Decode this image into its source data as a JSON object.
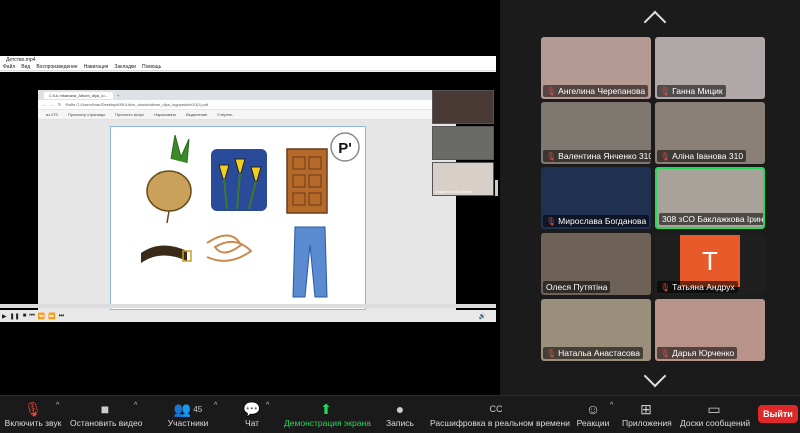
{
  "player": {
    "title": "Детство.mp4",
    "menu": [
      "Файл",
      "Вид",
      "Воспроизведение",
      "Навигация",
      "Закладки",
      "Помощь"
    ]
  },
  "browser": {
    "tab_title": "C:/Lk.mhahana_Albom_dlya_lo...",
    "url": "Файл  C:/Users/Ivan/Desktop/КЛК/Litvin_obuch/albom_dlya_logopeda%20(1).pdf",
    "zoom": "из 270",
    "tools": [
      "Просмотр страницы",
      "Прочесть вслух",
      "Нарисовать",
      "Выделение",
      "Стереть"
    ]
  },
  "pdf": {
    "badge": "Р'"
  },
  "mini_gallery": [
    {
      "name": ""
    },
    {
      "name": ""
    },
    {
      "name": "Angelina Kaka Zoom"
    }
  ],
  "gallery": [
    {
      "name": "Ангелина Черепанова",
      "muted": true,
      "bg": "#b59a93"
    },
    {
      "name": "Ганна Мицик",
      "muted": true,
      "bg": "#b0a8a8"
    },
    {
      "name": "Валентина Янченко  310",
      "muted": true,
      "bg": "#7f7870"
    },
    {
      "name": "Аліна Іванова 310",
      "muted": true,
      "bg": "#8a8078"
    },
    {
      "name": "Мирослава Богданова",
      "muted": true,
      "bg": "#203050"
    },
    {
      "name": "308 зСО Баклажкова Ірина",
      "muted": false,
      "bg": "#a9a29a"
    },
    {
      "name": "Олеся Путятіна",
      "muted": false,
      "bg": "#6e6258"
    },
    {
      "name": "Татьяна Андрух",
      "muted": true,
      "bg": "#e85a2a",
      "initial": "Т"
    },
    {
      "name": "Натальа Анастасова",
      "muted": true,
      "bg": "#9a8f7a"
    },
    {
      "name": "Дарья Юрченко",
      "muted": true,
      "bg": "#b8938a"
    }
  ],
  "toolbar": {
    "mute": "Включить звук",
    "video": "Остановить видео",
    "participants": "Участники",
    "participants_count": "45",
    "chat": "Чат",
    "share": "Демонстрация экрана",
    "record": "Запись",
    "captions": "Расшифровка в реальном времени",
    "reactions": "Реакции",
    "apps": "Приложения",
    "whiteboard": "Доски сообщений",
    "leave": "Выйти"
  },
  "colors": {
    "accent_green": "#23d959",
    "leave_red": "#e02828",
    "muted_red": "#e8453c"
  }
}
